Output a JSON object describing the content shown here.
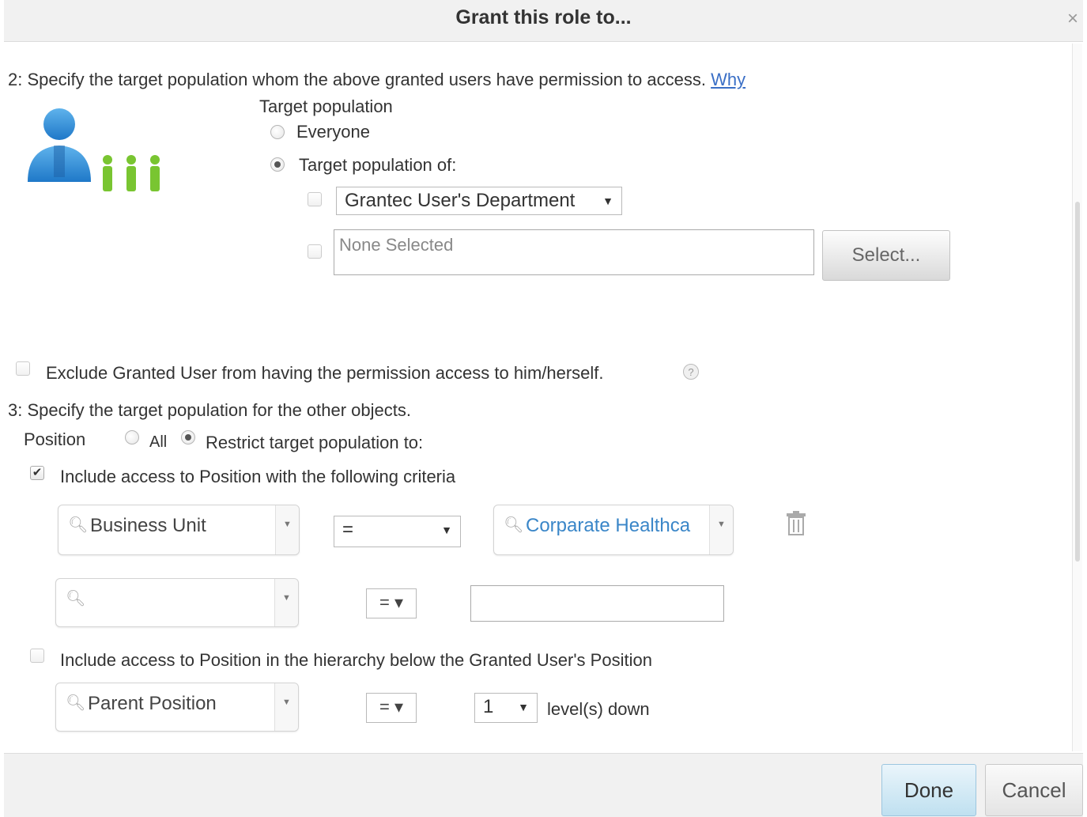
{
  "dialog": {
    "title": "Grant this role to...",
    "close_symbol": "×"
  },
  "step2": {
    "heading": "2: Specify the target population whom the above granted users have permission to access.",
    "why_link": "Why",
    "target_population_label": "Target population",
    "options": {
      "everyone": "Everyone",
      "target_of": "Target population of:"
    },
    "department_select": "Grantec User's Department",
    "none_selected": "None Selected",
    "select_button": "Select..."
  },
  "exclude": {
    "label": "Exclude Granted User from having the permission access to him/herself."
  },
  "step3": {
    "heading": "3: Specify the target population for the other objects.",
    "position_label": "Position",
    "all_label": "All",
    "restrict_label": "Restrict target population to:",
    "include_criteria_label": "Include access to Position with the following criteria",
    "criteria_row1": {
      "field": "Business Unit",
      "operator": "=",
      "value": "Corparate Healthca"
    },
    "criteria_row2": {
      "field": "",
      "operator": "= ▾",
      "value": ""
    },
    "hierarchy_label": "Include access to Position in the hierarchy below the Granted User's Position",
    "hierarchy_row": {
      "field": "Parent Position",
      "operator": "= ▾",
      "levels": "1",
      "levels_label": "level(s) down"
    }
  },
  "footer": {
    "done": "Done",
    "cancel": "Cancel"
  }
}
